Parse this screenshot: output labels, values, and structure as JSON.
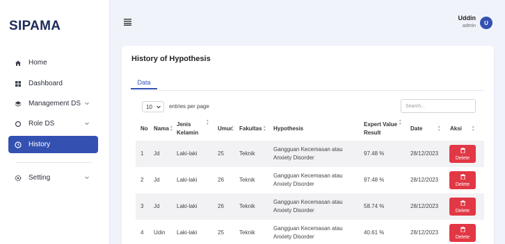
{
  "brand": "SIPAMA",
  "sidebar": {
    "items": [
      {
        "label": "Home",
        "icon": "home-icon"
      },
      {
        "label": "Dashboard",
        "icon": "grid-icon"
      },
      {
        "label": "Management DS",
        "icon": "layers-icon"
      },
      {
        "label": "Role DS",
        "icon": "shield-icon"
      },
      {
        "label": "History",
        "icon": "clock-icon"
      },
      {
        "label": "Setting",
        "icon": "gear-icon"
      }
    ]
  },
  "user": {
    "name": "Uddin",
    "role": "admin",
    "initial": "U"
  },
  "page": {
    "title": "History of Hypothesis",
    "tab": "Data"
  },
  "table_controls": {
    "length_value": "10",
    "length_suffix": "entries per page",
    "search_placeholder": "Search..."
  },
  "table": {
    "headers": {
      "no": "No",
      "nama": "Nama",
      "jenis_kelamin": "Jenis Kelamin",
      "umur": "Umur",
      "fakultas": "Fakultas",
      "hypothesis": "Hypothesis",
      "expert_value": "Expert Value Result",
      "date": "Date",
      "aksi": "Aksi"
    },
    "rows": [
      {
        "no": "1",
        "nama": "Jd",
        "jk": "Laki-laki",
        "umur": "25",
        "fakultas": "Teknik",
        "hypothesis": "Gangguan Kecemasan atau Anxiety Disorder",
        "result": "97.48 %",
        "date": "28/12/2023",
        "aksi": "Delete"
      },
      {
        "no": "2",
        "nama": "Jd",
        "jk": "Laki-laki",
        "umur": "26",
        "fakultas": "Teknik",
        "hypothesis": "Gangguan Kecemasan atau Anxiety Disorder",
        "result": "97.48 %",
        "date": "28/12/2023",
        "aksi": "Delete"
      },
      {
        "no": "3",
        "nama": "Jd",
        "jk": "Laki-laki",
        "umur": "26",
        "fakultas": "Teknik",
        "hypothesis": "Gangguan Kecemasan atau Anxiety Disorder",
        "result": "58.74 %",
        "date": "28/12/2023",
        "aksi": "Delete"
      },
      {
        "no": "4",
        "nama": "Udin",
        "jk": "Laki-laki",
        "umur": "25",
        "fakultas": "Teknik",
        "hypothesis": "Gangguan Kecemasan atau Anxiety Disorder",
        "result": "40.61 %",
        "date": "28/12/2023",
        "aksi": "Delete"
      }
    ]
  },
  "colors": {
    "primary": "#3451b2",
    "danger": "#e23744",
    "brand_text": "#1e2a5a"
  }
}
